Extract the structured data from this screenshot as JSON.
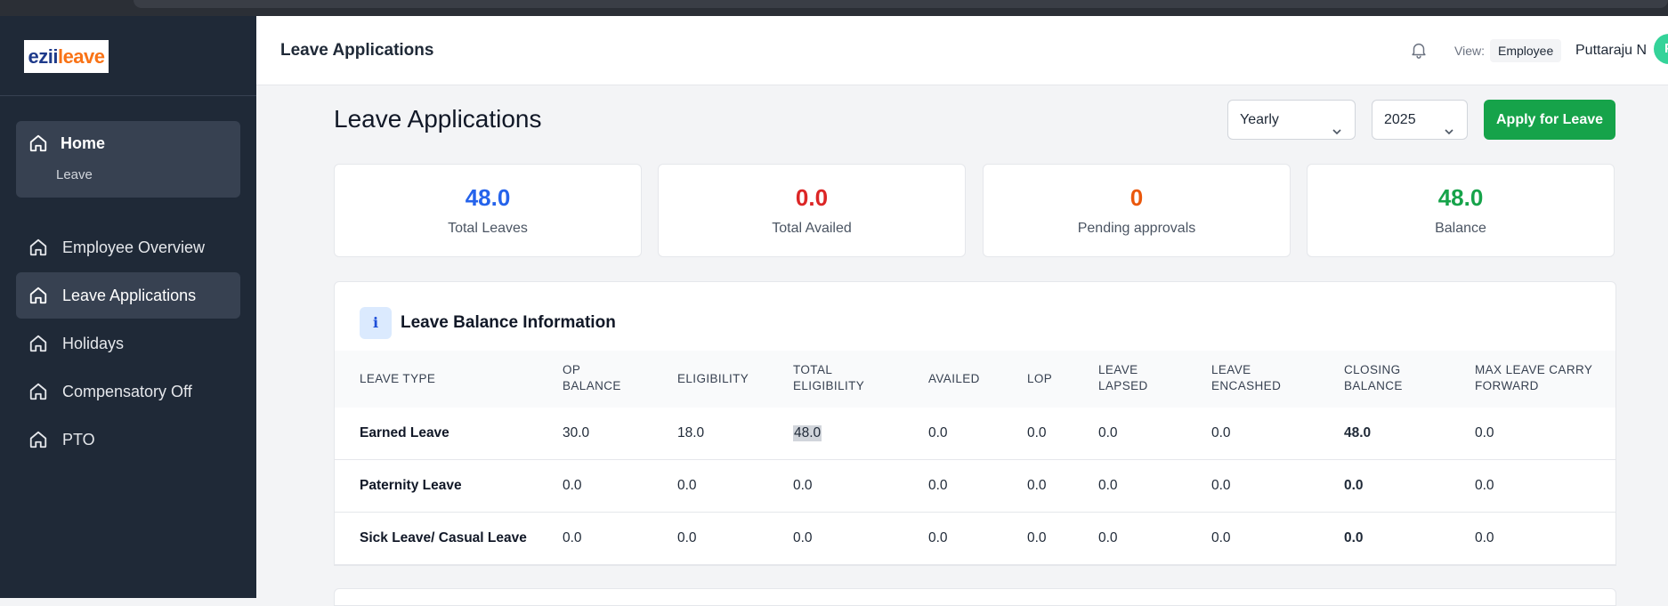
{
  "sidebar": {
    "logo": {
      "part1": "ezii",
      "part2": "leave"
    },
    "home": {
      "label": "Home",
      "sub": "Leave"
    },
    "items": [
      {
        "label": "Employee Overview"
      },
      {
        "label": "Leave Applications"
      },
      {
        "label": "Holidays"
      },
      {
        "label": "Compensatory Off"
      },
      {
        "label": "PTO"
      }
    ]
  },
  "header": {
    "title": "Leave Applications",
    "view_label": "View:",
    "view_value": "Employee",
    "user_name": "Puttaraju N",
    "avatar_initial": "P"
  },
  "main": {
    "title": "Leave Applications",
    "period_select": "Yearly",
    "year_select": "2025",
    "apply_button": "Apply for Leave"
  },
  "stats": [
    {
      "value": "48.0",
      "label": "Total Leaves",
      "color": "#2563eb"
    },
    {
      "value": "0.0",
      "label": "Total Availed",
      "color": "#dc2626"
    },
    {
      "value": "0",
      "label": "Pending approvals",
      "color": "#ea580c"
    },
    {
      "value": "48.0",
      "label": "Balance",
      "color": "#16a34a"
    }
  ],
  "balance_panel": {
    "icon_text": "i",
    "title": "Leave Balance Information",
    "columns": [
      {
        "line1": "LEAVE TYPE",
        "line2": ""
      },
      {
        "line1": "OP",
        "line2": "BALANCE"
      },
      {
        "line1": "ELIGIBILITY",
        "line2": ""
      },
      {
        "line1": "TOTAL",
        "line2": "ELIGIBILITY"
      },
      {
        "line1": "AVAILED",
        "line2": ""
      },
      {
        "line1": "LOP",
        "line2": ""
      },
      {
        "line1": "LEAVE",
        "line2": "LAPSED"
      },
      {
        "line1": "LEAVE",
        "line2": "ENCASHED"
      },
      {
        "line1": "CLOSING",
        "line2": "BALANCE"
      },
      {
        "line1": "MAX LEAVE CARRY",
        "line2": "FORWARD"
      }
    ],
    "rows": [
      [
        "Earned Leave",
        "30.0",
        "18.0",
        "48.0",
        "0.0",
        "0.0",
        "0.0",
        "0.0",
        "48.0",
        "0.0"
      ],
      [
        "Paternity Leave",
        "0.0",
        "0.0",
        "0.0",
        "0.0",
        "0.0",
        "0.0",
        "0.0",
        "0.0",
        "0.0"
      ],
      [
        "Sick Leave/ Casual Leave",
        "0.0",
        "0.0",
        "0.0",
        "0.0",
        "0.0",
        "0.0",
        "0.0",
        "0.0",
        "0.0"
      ]
    ]
  }
}
